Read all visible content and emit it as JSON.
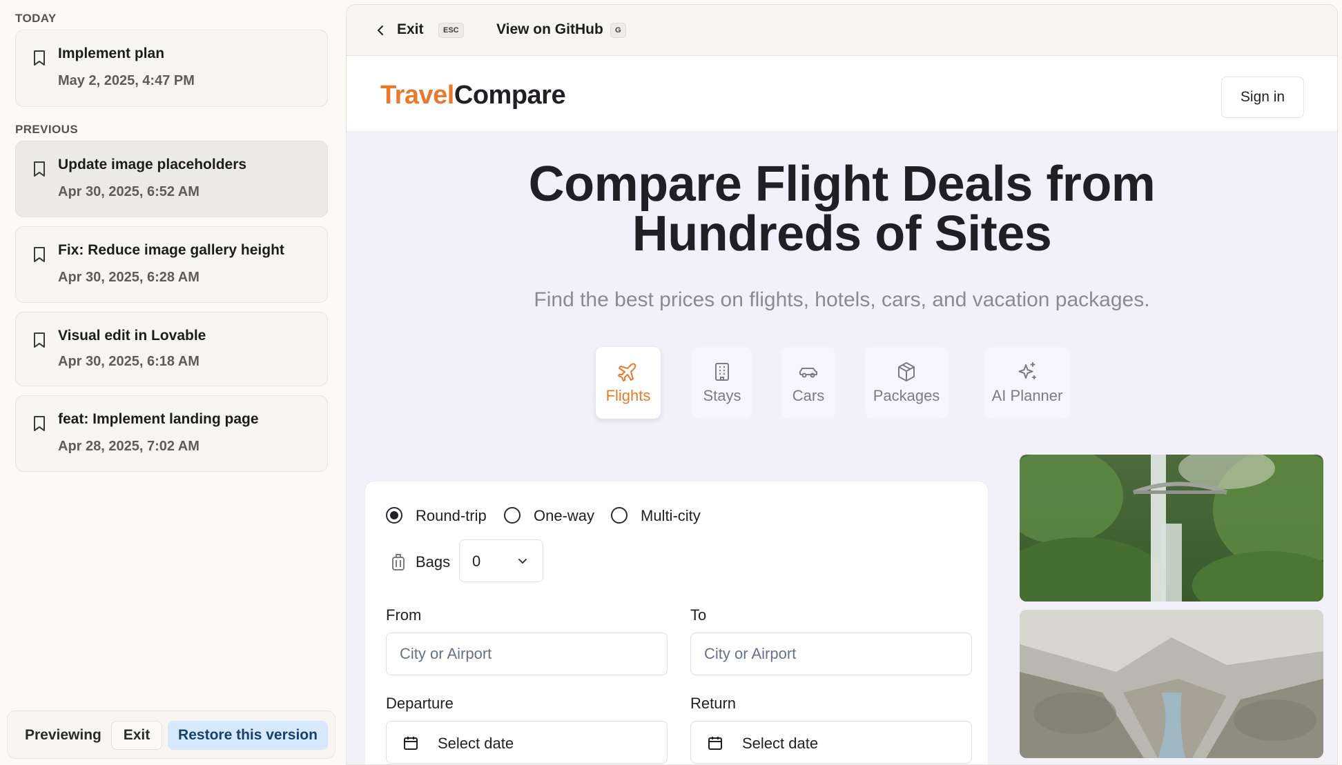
{
  "sidebar": {
    "today_label": "TODAY",
    "previous_label": "PREVIOUS",
    "today": [
      {
        "title": "Implement plan",
        "date": "May 2, 2025, 4:47 PM"
      }
    ],
    "previous": [
      {
        "title": "Update image placeholders",
        "date": "Apr 30, 2025, 6:52 AM"
      },
      {
        "title": "Fix: Reduce image gallery height",
        "date": "Apr 30, 2025, 6:28 AM"
      },
      {
        "title": "Visual edit in Lovable",
        "date": "Apr 30, 2025, 6:18 AM"
      },
      {
        "title": "feat: Implement landing page",
        "date": "Apr 28, 2025, 7:02 AM"
      }
    ],
    "bottom": {
      "previewing": "Previewing",
      "exit": "Exit",
      "restore": "Restore this version"
    }
  },
  "topbar": {
    "exit_label": "Exit",
    "exit_key": "ESC",
    "github_label": "View on GitHub",
    "github_key": "G"
  },
  "site": {
    "logo_part1": "Travel",
    "logo_part2": "Compare",
    "sign_in": "Sign in",
    "hero_title_line1": "Compare Flight Deals from",
    "hero_title_line2": "Hundreds of Sites",
    "hero_subtitle": "Find the best prices on flights, hotels, cars, and vacation packages.",
    "tabs": [
      {
        "label": "Flights",
        "icon": "plane-icon",
        "active": true
      },
      {
        "label": "Stays",
        "icon": "building-icon"
      },
      {
        "label": "Cars",
        "icon": "car-icon"
      },
      {
        "label": "Packages",
        "icon": "package-icon"
      },
      {
        "label": "AI Planner",
        "icon": "sparkles-icon"
      }
    ],
    "search": {
      "trip_types": [
        "Round-trip",
        "One-way",
        "Multi-city"
      ],
      "selected_trip": "Round-trip",
      "bags_label": "Bags",
      "bags_value": "0",
      "from_label": "From",
      "from_placeholder": "City or Airport",
      "to_label": "To",
      "to_placeholder": "City or Airport",
      "departure_label": "Departure",
      "departure_value": "Select date",
      "return_label": "Return",
      "return_value": "Select date"
    }
  },
  "colors": {
    "brand_orange": "#e87a2e",
    "hero_bg": "#f2f1fa",
    "restore_bg": "#d6e8fb"
  }
}
